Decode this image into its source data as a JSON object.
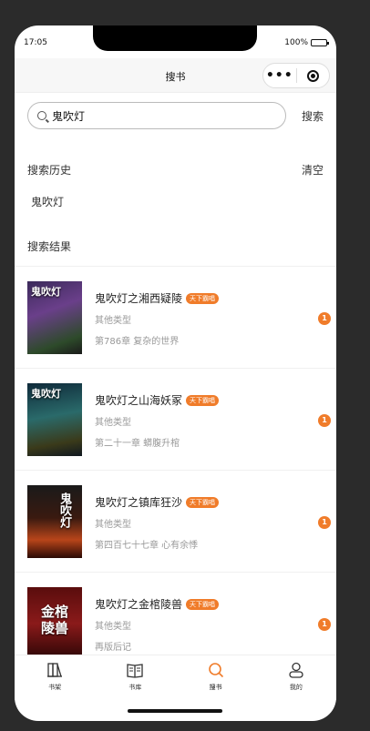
{
  "status_bar": {
    "time": "17:05",
    "battery": "100%"
  },
  "nav": {
    "title": "搜书",
    "more_icon": "more-dots-icon",
    "close_icon": "target-circle-icon"
  },
  "search": {
    "value": "鬼吹灯",
    "placeholder": "",
    "button": "搜索"
  },
  "history": {
    "heading": "搜索历史",
    "clear": "清空",
    "items": [
      "鬼吹灯"
    ]
  },
  "results": {
    "heading": "搜索结果",
    "books": [
      {
        "cover_text": "鬼吹灯",
        "title": "鬼吹灯之湘西疑陵",
        "tag": "天下霸唱",
        "type": "其他类型",
        "chapter": "第786章 复杂的世界",
        "badge": "1"
      },
      {
        "cover_text": "鬼吹灯",
        "title": "鬼吹灯之山海妖冢",
        "tag": "天下霸唱",
        "type": "其他类型",
        "chapter": "第二十一章 蟒腹升棺",
        "badge": "1"
      },
      {
        "cover_text": "鬼吹灯",
        "title": "鬼吹灯之镇库狂沙",
        "tag": "天下霸唱",
        "type": "其他类型",
        "chapter": "第四百七十七章 心有余悸",
        "badge": "1"
      },
      {
        "cover_text": "金棺陵兽",
        "title": "鬼吹灯之金棺陵兽",
        "tag": "天下霸唱",
        "type": "其他类型",
        "chapter": "再版后记",
        "badge": "1"
      }
    ]
  },
  "tabbar": [
    {
      "label": "书架",
      "icon": "bookshelf-icon"
    },
    {
      "label": "书库",
      "icon": "book-icon"
    },
    {
      "label": "搜书",
      "icon": "search-icon"
    },
    {
      "label": "我的",
      "icon": "user-icon"
    }
  ],
  "colors": {
    "accent": "#f07c2a",
    "active_tab": "#f07c2a"
  }
}
